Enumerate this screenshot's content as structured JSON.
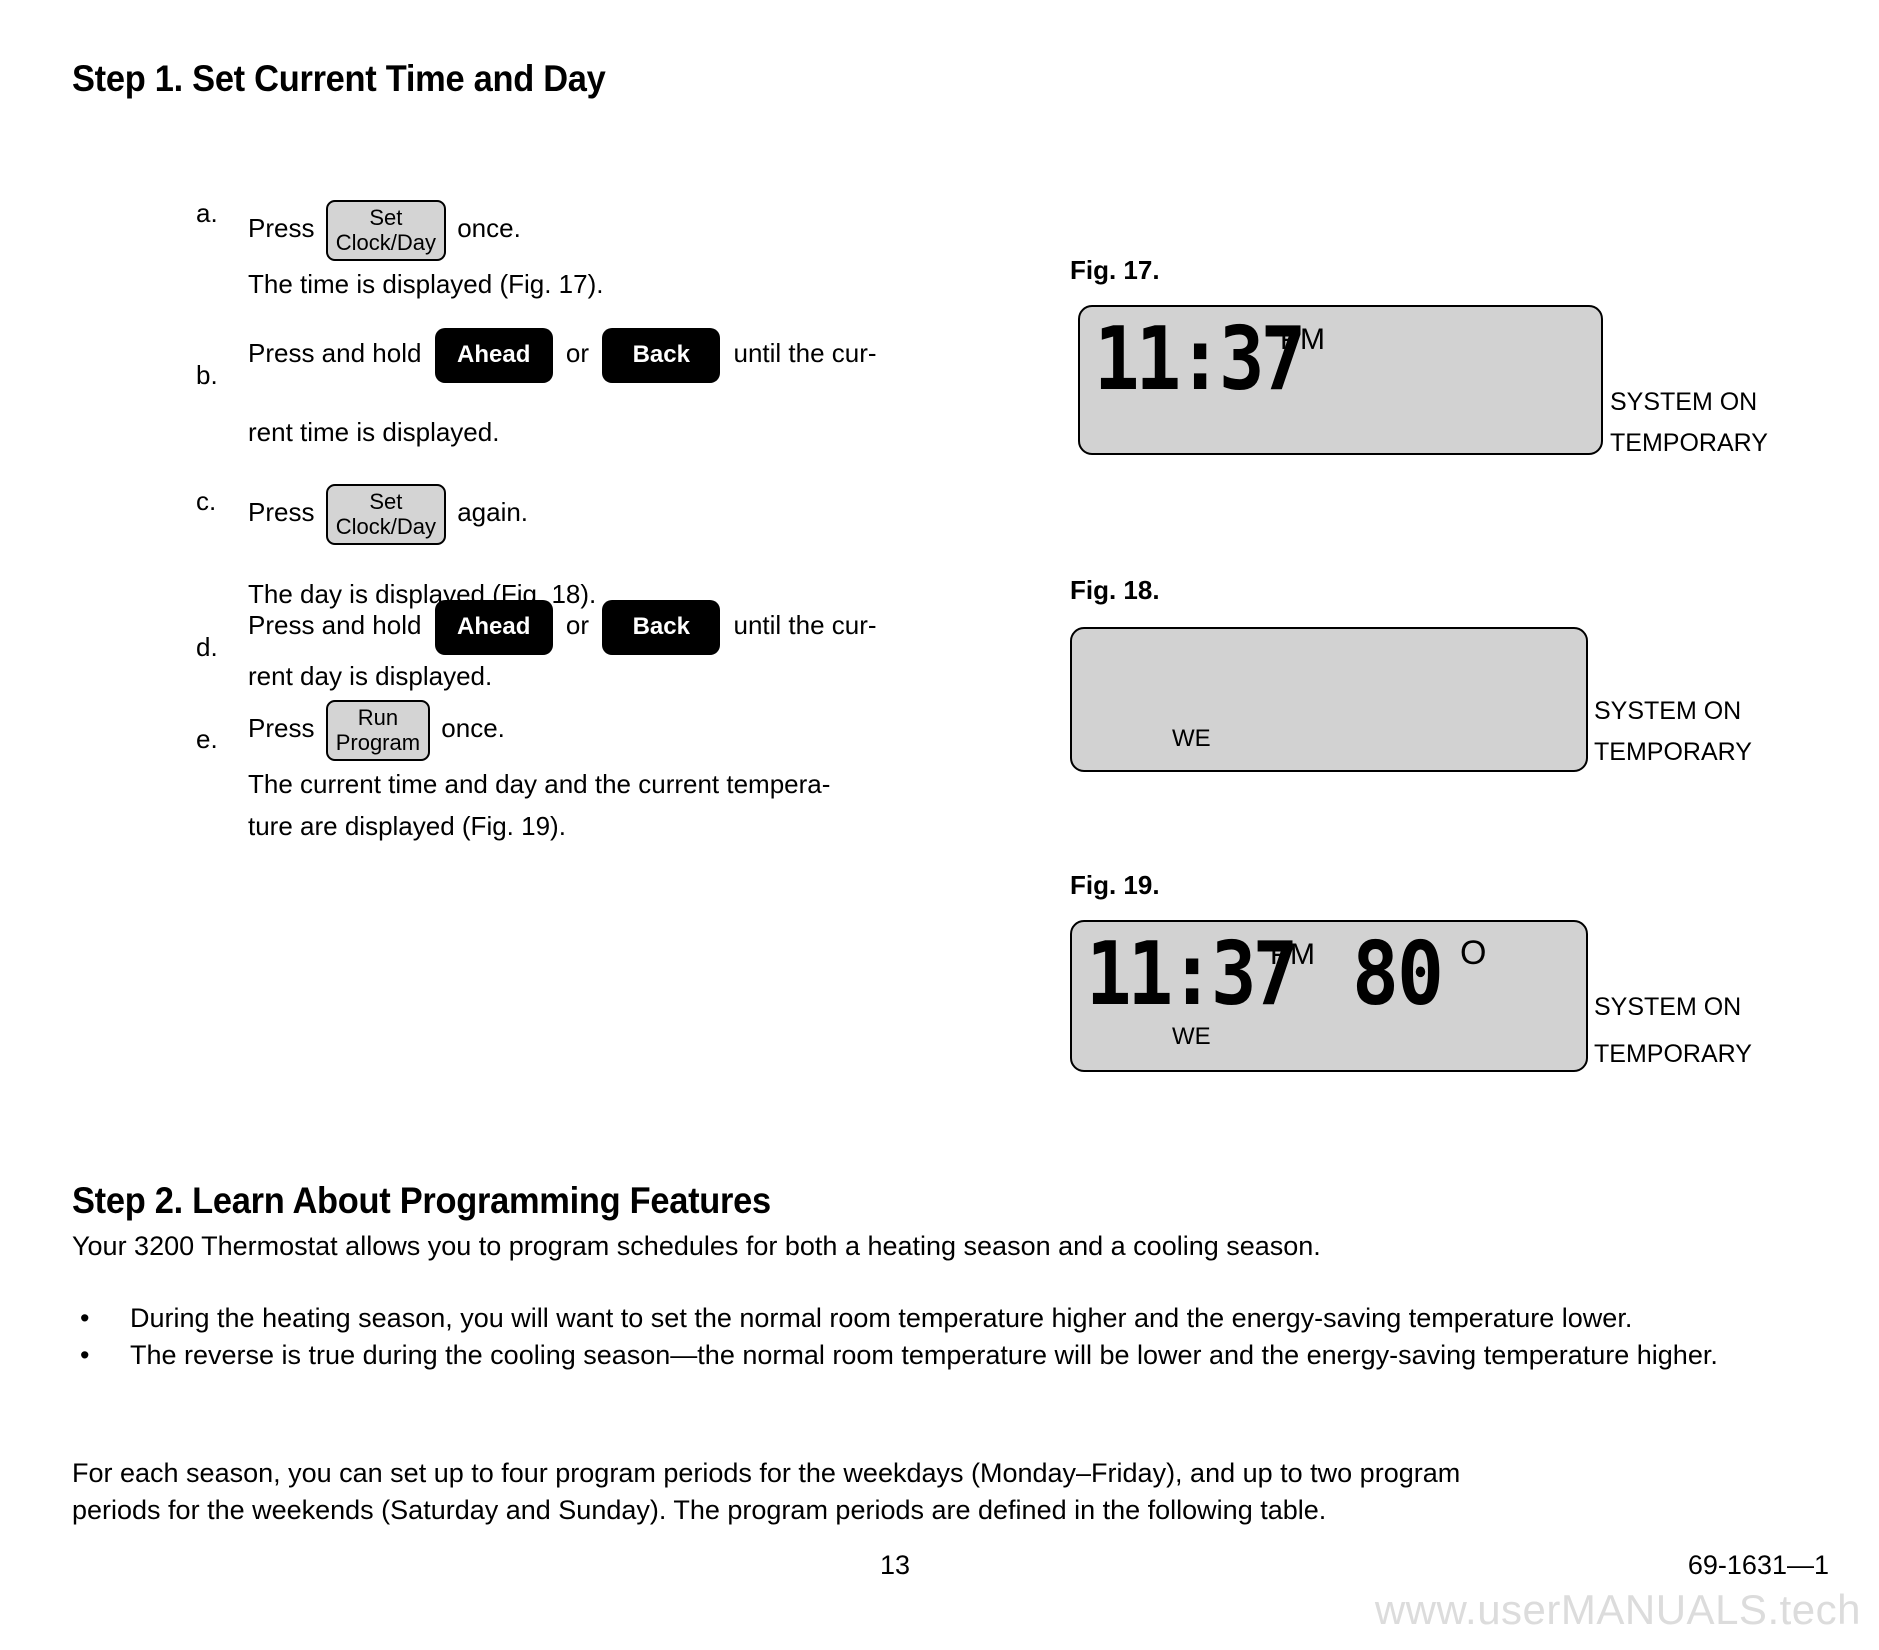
{
  "document": {
    "step1": {
      "heading": "Step 1. Set Current Time and Day",
      "items": [
        {
          "marker": "a.",
          "pre": "Press",
          "button": {
            "line1": "Set",
            "line2": "Clock/Day",
            "style": "gray"
          },
          "post": "once.",
          "detail": "The time is displayed (Fig. 17)."
        },
        {
          "marker": "b.",
          "pre": "Press and hold",
          "button1": {
            "label": "Ahead",
            "style": "black"
          },
          "conjunction": "or",
          "button2": {
            "label": "Back",
            "style": "black"
          },
          "post": "until the cur-",
          "detail": "rent time is displayed."
        },
        {
          "marker": "c.",
          "pre": "Press",
          "button": {
            "line1": "Set",
            "line2": "Clock/Day",
            "style": "gray"
          },
          "post": "again.",
          "detail": "The day is displayed (Fig. 18)."
        },
        {
          "marker": "d.",
          "pre": "Press and hold",
          "button1": {
            "label": "Ahead",
            "style": "black"
          },
          "conjunction": "or",
          "button2": {
            "label": "Back",
            "style": "black"
          },
          "post": "until the cur-",
          "detail": "rent day is displayed."
        },
        {
          "marker": "e.",
          "pre": "Press",
          "button": {
            "line1": "Run",
            "line2": "Program",
            "style": "gray"
          },
          "post": "once.",
          "detail_line1": "The current time and day and the current tempera-",
          "detail_line2": "ture are displayed (Fig. 19)."
        }
      ]
    },
    "figures": [
      {
        "label": "Fig. 17.",
        "display": {
          "time": "11:37",
          "ampm": "PM",
          "temperature": "",
          "degree": "",
          "day": ""
        },
        "side_labels": [
          "SYSTEM ON",
          "TEMPORARY"
        ]
      },
      {
        "label": "Fig. 18.",
        "display": {
          "time": "",
          "ampm": "",
          "temperature": "",
          "degree": "",
          "day": "WE"
        },
        "side_labels": [
          "SYSTEM ON",
          "TEMPORARY"
        ]
      },
      {
        "label": "Fig. 19.",
        "display": {
          "time": "11:37",
          "ampm": "PM",
          "temperature": "80",
          "degree": "O",
          "day": "WE"
        },
        "side_labels": [
          "SYSTEM ON",
          "TEMPORARY"
        ]
      }
    ],
    "step2": {
      "heading": "Step 2. Learn About Programming Features",
      "intro": "Your 3200 Thermostat allows you to program schedules for both a heating season and a cooling season.",
      "bullets": [
        "During the heating season, you will want to set the normal room temperature higher and the energy-saving temperature lower.",
        "The reverse is true during the cooling season—the normal room temperature will be lower and the energy-saving temperature higher."
      ],
      "bullet_marker": "•",
      "closing_line1": "For each season, you can set up to four program periods for the weekdays (Monday–Friday), and up to two program",
      "closing_line2": "periods for the weekends (Saturday and Sunday). The program periods are defined in the following table."
    },
    "footer": {
      "page_number": "13",
      "document_code": "69-1631—1",
      "watermark": "www.userMANUALS.tech"
    },
    "colors": {
      "lcd_background": "#d2d2d2",
      "button_gray": "#d4d4d4",
      "button_black": "#000000",
      "watermark": "#dcdcdc"
    }
  }
}
